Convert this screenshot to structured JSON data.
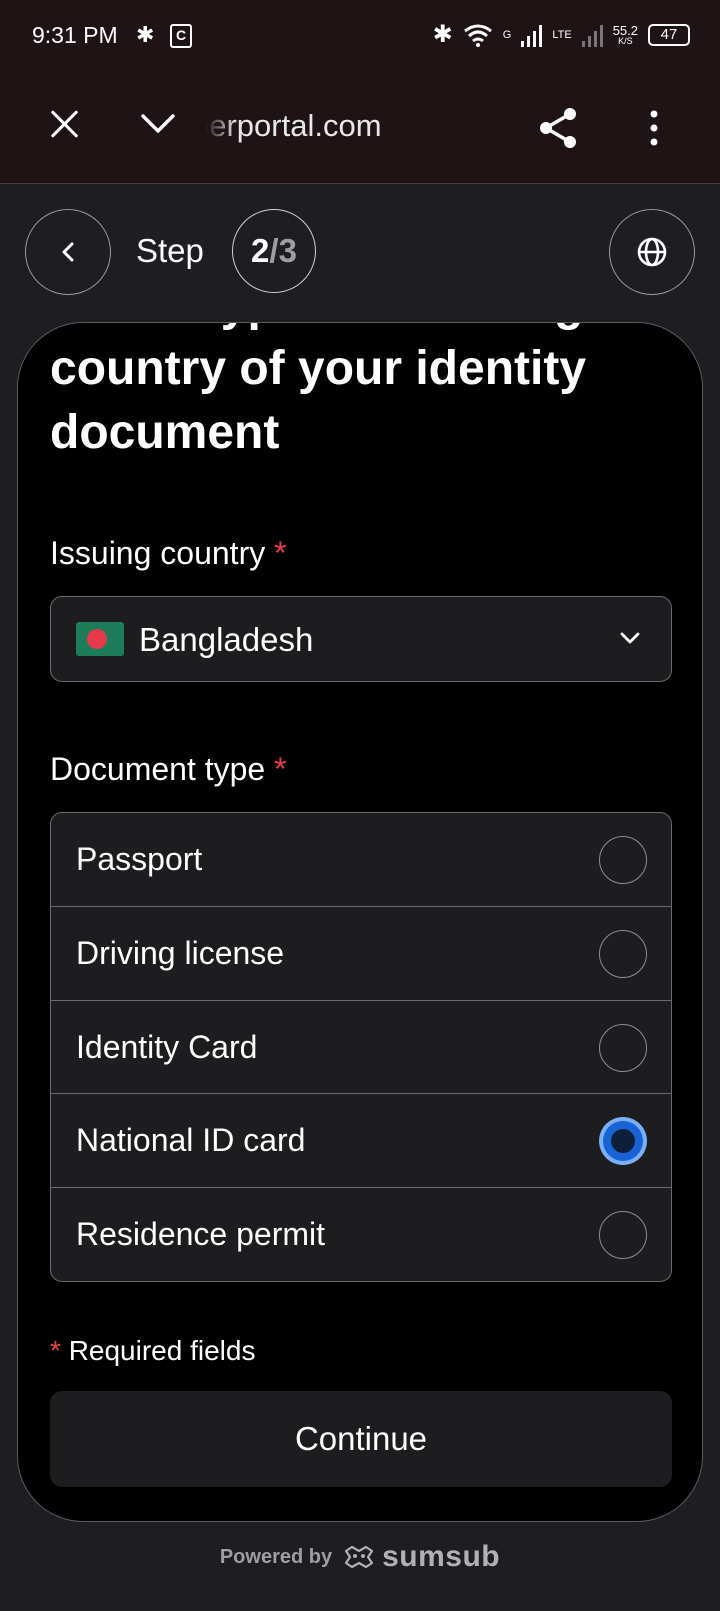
{
  "status_bar": {
    "time": "9:31 PM",
    "network_g": "G",
    "network_lte": "LTE",
    "speed_value": "55.2",
    "speed_unit": "K/S",
    "battery": "47"
  },
  "browser": {
    "url": "perportal.com"
  },
  "header": {
    "step_label": "Step",
    "step_current": "2",
    "step_separator": "/",
    "step_total": "3"
  },
  "card": {
    "title": "Select type and issuing country of your identity document",
    "country_label": "Issuing country",
    "country_value": "Bangladesh",
    "doc_type_label": "Document type",
    "required_marker": "*",
    "document_types": [
      {
        "label": "Passport",
        "selected": false
      },
      {
        "label": "Driving license",
        "selected": false
      },
      {
        "label": "Identity Card",
        "selected": false
      },
      {
        "label": "National ID card",
        "selected": true
      },
      {
        "label": "Residence permit",
        "selected": false
      }
    ],
    "required_note": "Required fields",
    "continue_label": "Continue"
  },
  "footer": {
    "powered_by": "Powered by",
    "brand": "sumsub"
  },
  "colors": {
    "accent": "#1a63d6",
    "required": "#e8424c",
    "flag_green": "#1d7c5a",
    "flag_red": "#e63a4a"
  }
}
